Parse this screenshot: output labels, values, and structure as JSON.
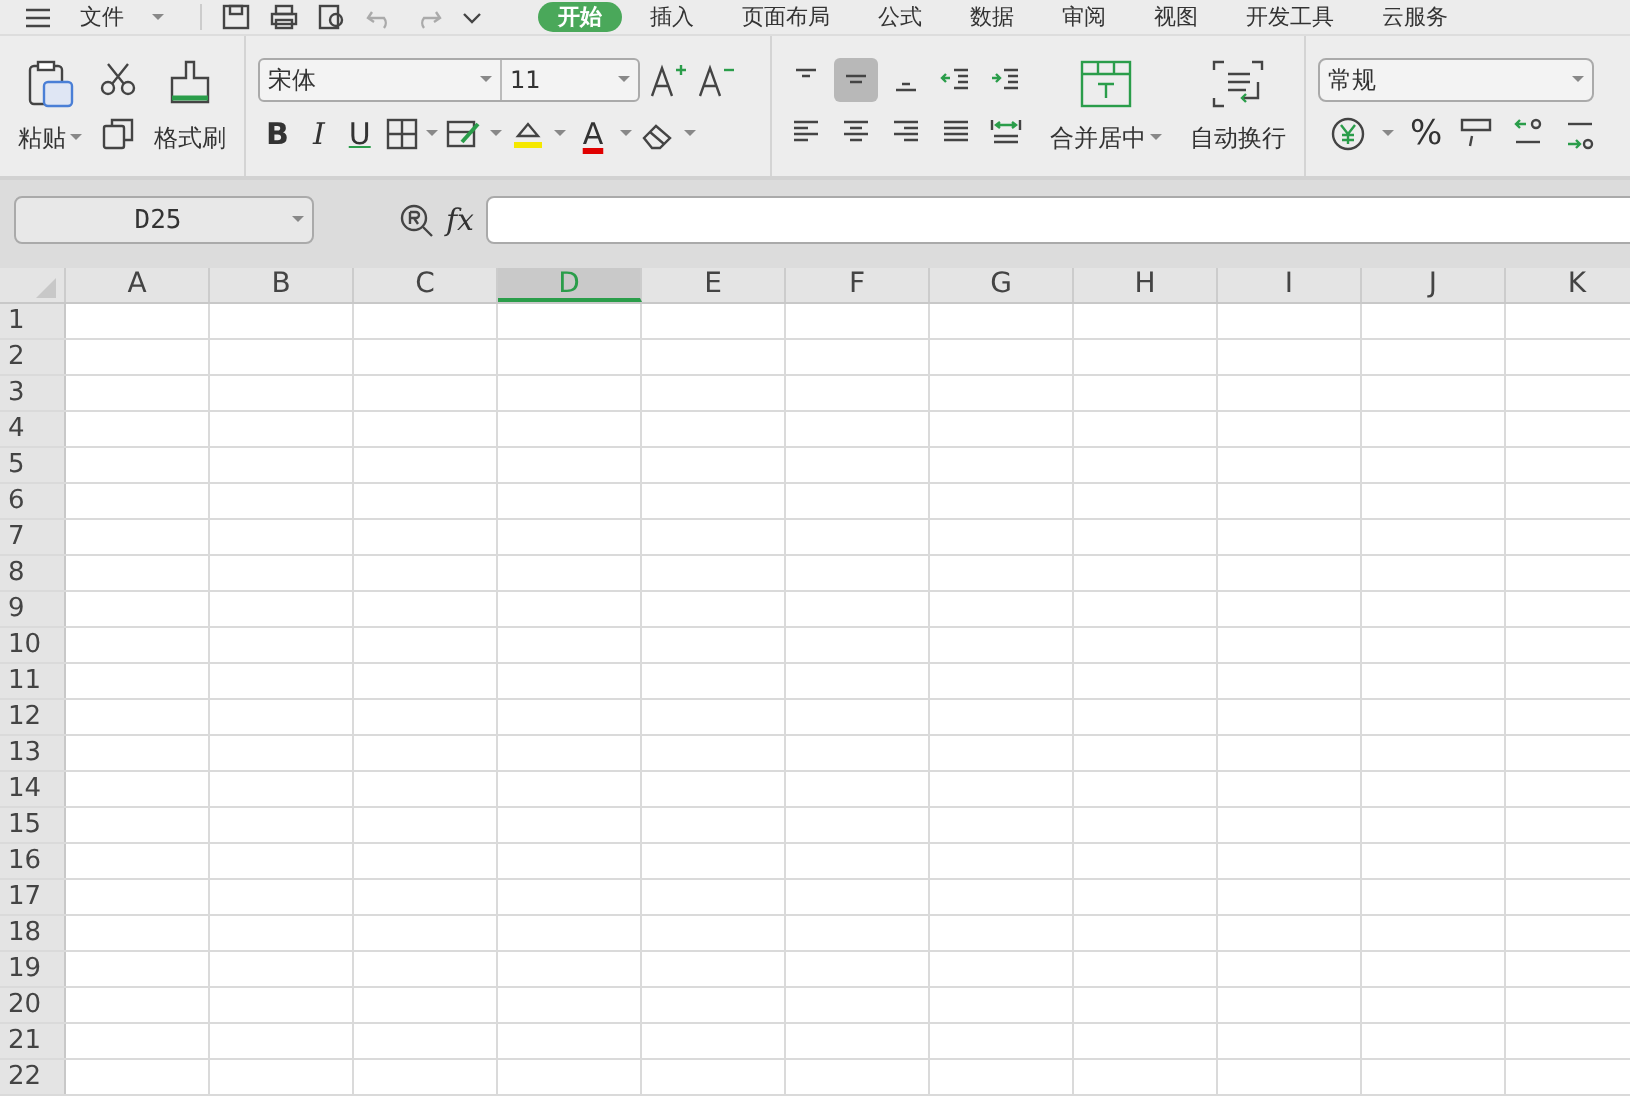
{
  "menu_tabs": [
    {
      "label": "文件",
      "selected": false
    },
    {
      "label": "开始",
      "selected": true
    },
    {
      "label": "插入",
      "selected": false
    },
    {
      "label": "页面布局",
      "selected": false
    },
    {
      "label": "公式",
      "selected": false
    },
    {
      "label": "数据",
      "selected": false
    },
    {
      "label": "审阅",
      "selected": false
    },
    {
      "label": "视图",
      "selected": false
    },
    {
      "label": "开发工具",
      "selected": false
    },
    {
      "label": "云服务",
      "selected": false
    }
  ],
  "clipboard": {
    "paste": "粘贴",
    "format_painter": "格式刷"
  },
  "font": {
    "name": "宋体",
    "size": "11",
    "bold": "B",
    "italic": "I",
    "underline": "U",
    "font_color": "A"
  },
  "alignment": {
    "buttons": [
      {
        "kind": "top",
        "selected": false
      },
      {
        "kind": "middle",
        "selected": true
      },
      {
        "kind": "bottom",
        "selected": false
      },
      {
        "kind": "outdent",
        "selected": false
      },
      {
        "kind": "indent",
        "selected": false
      },
      {
        "kind": "left",
        "selected": false
      },
      {
        "kind": "center",
        "selected": false
      },
      {
        "kind": "right",
        "selected": false
      },
      {
        "kind": "justify",
        "selected": false
      },
      {
        "kind": "distribute",
        "selected": false
      }
    ],
    "merge": "合并居中",
    "wrap": "自动换行"
  },
  "number": {
    "format": "常规",
    "percent": "%"
  },
  "formula_bar": {
    "name_box": "D25",
    "fx": "fx"
  },
  "sheet": {
    "columns": [
      {
        "label": "A",
        "selected": false
      },
      {
        "label": "B",
        "selected": false
      },
      {
        "label": "C",
        "selected": false
      },
      {
        "label": "D",
        "selected": true
      },
      {
        "label": "E",
        "selected": false
      },
      {
        "label": "F",
        "selected": false
      },
      {
        "label": "G",
        "selected": false
      },
      {
        "label": "H",
        "selected": false
      },
      {
        "label": "I",
        "selected": false
      },
      {
        "label": "J",
        "selected": false
      },
      {
        "label": "K",
        "selected": false
      }
    ],
    "rows": [
      "1",
      "2",
      "3",
      "4",
      "5",
      "6",
      "7",
      "8",
      "9",
      "10",
      "11",
      "12",
      "13",
      "14",
      "15",
      "16",
      "17",
      "18",
      "19",
      "20",
      "21",
      "22"
    ]
  }
}
